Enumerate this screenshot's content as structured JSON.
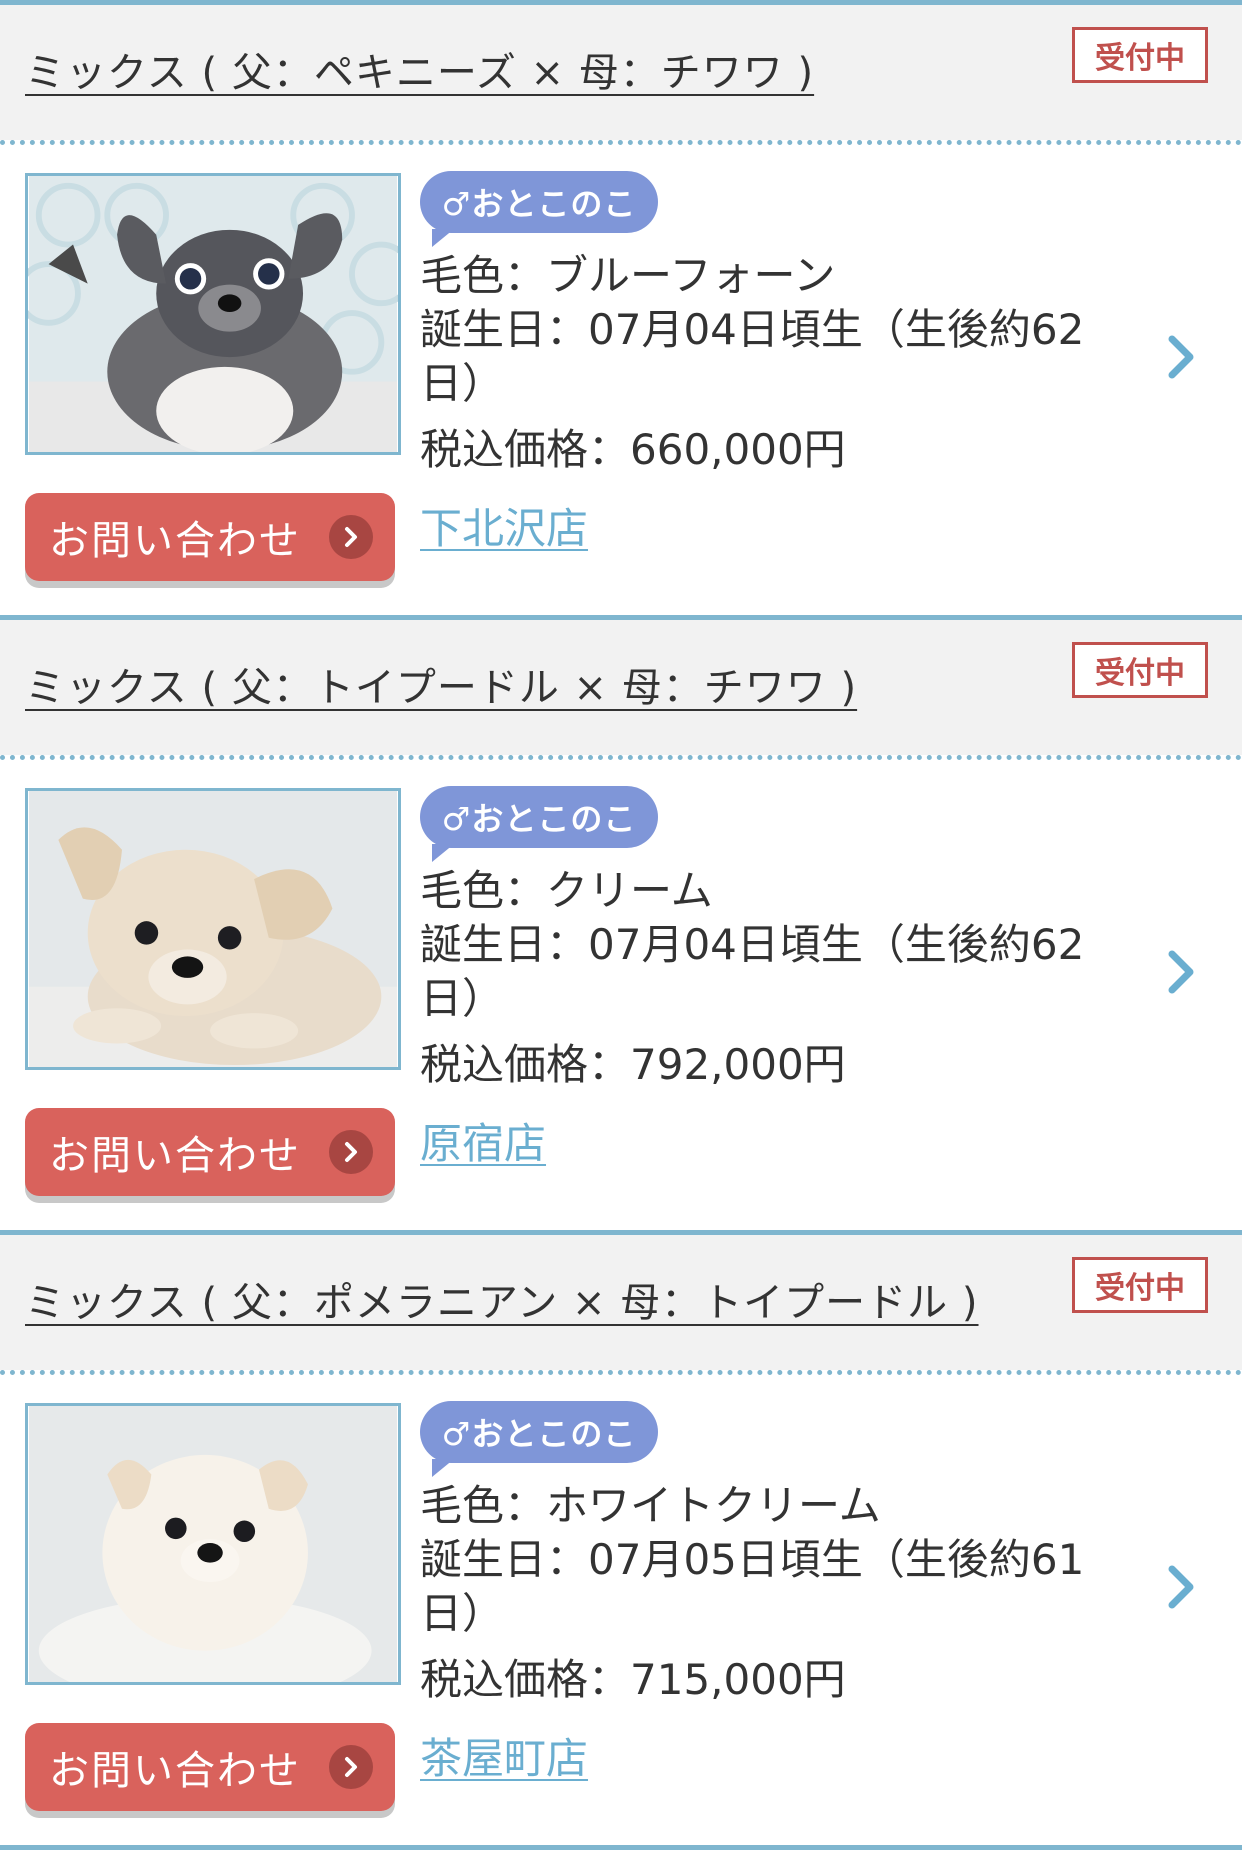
{
  "listings": [
    {
      "breed": "ミックス ( 父：ペキニーズ × 母：チワワ )",
      "status": "受付中",
      "gender": "♂おとこのこ",
      "coat": "毛色：ブルーフォーン",
      "birthday_line1": "誕生日：07月04日頃生（生後約62",
      "birthday_line2": "日）",
      "price": "税込価格：660,000円",
      "shop": "下北沢店",
      "button": "お問い合わせ"
    },
    {
      "breed": "ミックス ( 父：トイプードル × 母：チワワ )",
      "status": "受付中",
      "gender": "♂おとこのこ",
      "coat": "毛色：クリーム",
      "birthday_line1": "誕生日：07月04日頃生（生後約62",
      "birthday_line2": "日）",
      "price": "税込価格：792,000円",
      "shop": "原宿店",
      "button": "お問い合わせ"
    },
    {
      "breed": "ミックス ( 父：ポメラニアン × 母：トイプードル )",
      "status": "受付中",
      "gender": "♂おとこのこ",
      "coat": "毛色：ホワイトクリーム",
      "birthday_line1": "誕生日：07月05日頃生（生後約61",
      "birthday_line2": "日）",
      "price": "税込価格：715,000円",
      "shop": "茶屋町店",
      "button": "お問い合わせ"
    }
  ],
  "colors": {
    "accent_blue": "#7fb6cf",
    "status_red": "#c0504d",
    "button_red": "#d9625c",
    "gender_blue": "#7f96d8",
    "link_blue": "#6aaed0"
  },
  "icons": {
    "chevron": "chevron-right-icon",
    "button_arrow": "arrow-circle-icon"
  }
}
